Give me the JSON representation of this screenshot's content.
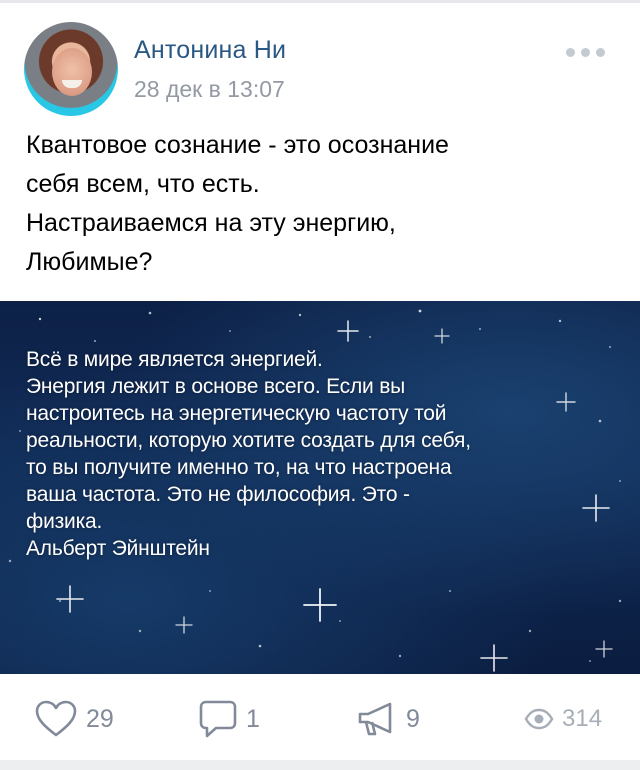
{
  "post": {
    "author": "Антонина Ни",
    "date": "28 дек в 13:07",
    "text_lines": [
      "Квантовое сознание - это осознание",
      "себя всем, что есть.",
      "Настраиваемся на эту энергию,",
      "Любимые?"
    ]
  },
  "image": {
    "quote_lines": [
      "Всё в мире является энергией.",
      "Энергия лежит в основе всего. Если вы",
      "настроитесь на энергетическую частоту той",
      "реальности, которую хотите создать для себя,",
      "то вы получите именно то, на что настроена",
      "ваша частота. Это не философия. Это -",
      "физика.",
      "Альберт Эйнштейн"
    ]
  },
  "actions": {
    "likes": "29",
    "comments": "1",
    "shares": "9",
    "views": "314"
  },
  "icons": {
    "like": "heart-icon",
    "comment": "comment-bubble-icon",
    "share": "megaphone-icon",
    "views": "eye-icon",
    "more": "more-dots-icon"
  },
  "colors": {
    "author_link": "#2a5885",
    "meta_gray": "#939aa3",
    "action_gray": "#828a99",
    "image_bg": "#0d2147"
  }
}
